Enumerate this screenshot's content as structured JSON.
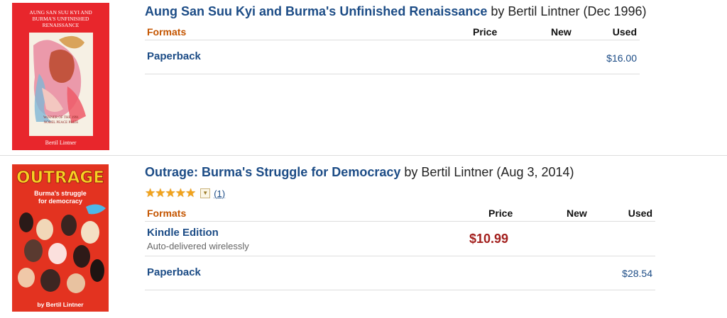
{
  "results": [
    {
      "title": "Aung San Suu Kyi and Burma's Unfinished Renaissance",
      "byline": " by Bertil Lintner (Dec 1996)",
      "cover": {
        "text_lines": [
          "AUNG SAN SUU KYI AND",
          "BURMA'S UNFINISHED",
          "RENAISSANCE"
        ],
        "award_lines": [
          "WINNER OF THE 1991",
          "NOBEL PEACE PRIZE"
        ],
        "author": "Bertil Lintner"
      },
      "table_headers": {
        "formats": "Formats",
        "price": "Price",
        "new": "New",
        "used": "Used"
      },
      "formats": [
        {
          "name": "Paperback",
          "price": "",
          "new": "",
          "used": "$16.00"
        }
      ]
    },
    {
      "title": "Outrage: Burma's Struggle for Democracy",
      "byline": " by Bertil Lintner (Aug 3, 2014)",
      "rating": {
        "stars": "★★★★★",
        "dropdown_icon": "chevron-down-icon",
        "count": "(1)"
      },
      "cover": {
        "title": "OUTRAGE",
        "subtitle_lines": [
          "Burma's struggle",
          "for democracy"
        ],
        "author": "by Bertil Lintner"
      },
      "table_headers": {
        "formats": "Formats",
        "price": "Price",
        "new": "New",
        "used": "Used"
      },
      "formats": [
        {
          "name": "Kindle Edition",
          "sub": "Auto-delivered wirelessly",
          "price": "$10.99",
          "new": "",
          "used": ""
        },
        {
          "name": "Paperback",
          "price": "",
          "new": "",
          "used": "$28.54"
        }
      ]
    }
  ],
  "colors": {
    "title_link": "#1c4c86",
    "formats_header": "#c45500",
    "price": "#a3201e",
    "stars": "#f2a31c",
    "cover1_bg": "#e8262c",
    "cover2_bg": "#e33320"
  }
}
